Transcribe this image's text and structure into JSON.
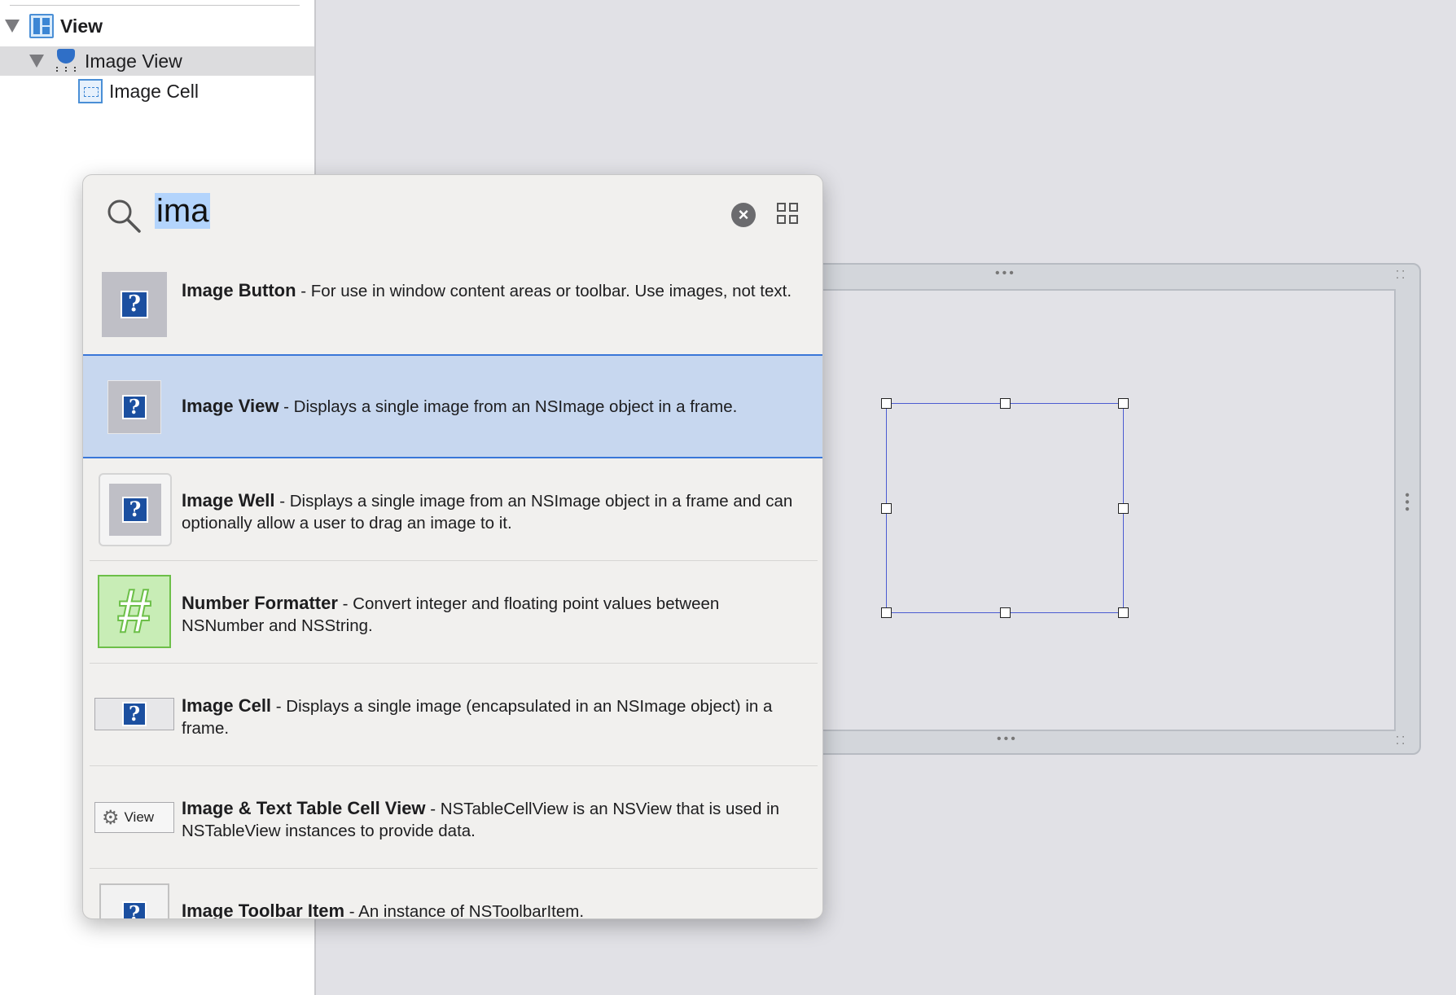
{
  "outline": {
    "items": [
      {
        "label": "View",
        "bold": true
      },
      {
        "label": "Image View",
        "bold": false
      },
      {
        "label": "Image Cell",
        "bold": false
      }
    ]
  },
  "library": {
    "search": {
      "value": "ima"
    },
    "items": [
      {
        "title": "Image Button",
        "description": " - For use in window content areas or toolbar. Use images, not text."
      },
      {
        "title": "Image View",
        "description": " - Displays a single image from an NSImage object in a frame."
      },
      {
        "title": "Image Well",
        "description": " - Displays a single image from an NSImage object in a frame and can optionally allow a user to drag an image to it."
      },
      {
        "title": "Number Formatter",
        "description": " - Convert integer and floating point values between NSNumber and NSString."
      },
      {
        "title": "Image Cell",
        "description": " - Displays a single image (encapsulated in an NSImage object) in a frame."
      },
      {
        "title": "Image & Text Table Cell View",
        "description": " - NSTableCellView is an NSView that is used in NSTableView instances to provide data."
      },
      {
        "title": "Image Toolbar Item",
        "description": " - An instance of NSToolbarItem."
      }
    ],
    "thumb_labels": {
      "text_cell_view": "View"
    },
    "icons": {
      "placeholder": "?",
      "formatter": "#",
      "clear": "×"
    }
  },
  "colors": {
    "selection": "#c7d7ef",
    "accent": "#3a77d8",
    "view_selection": "#4b5bd1"
  }
}
